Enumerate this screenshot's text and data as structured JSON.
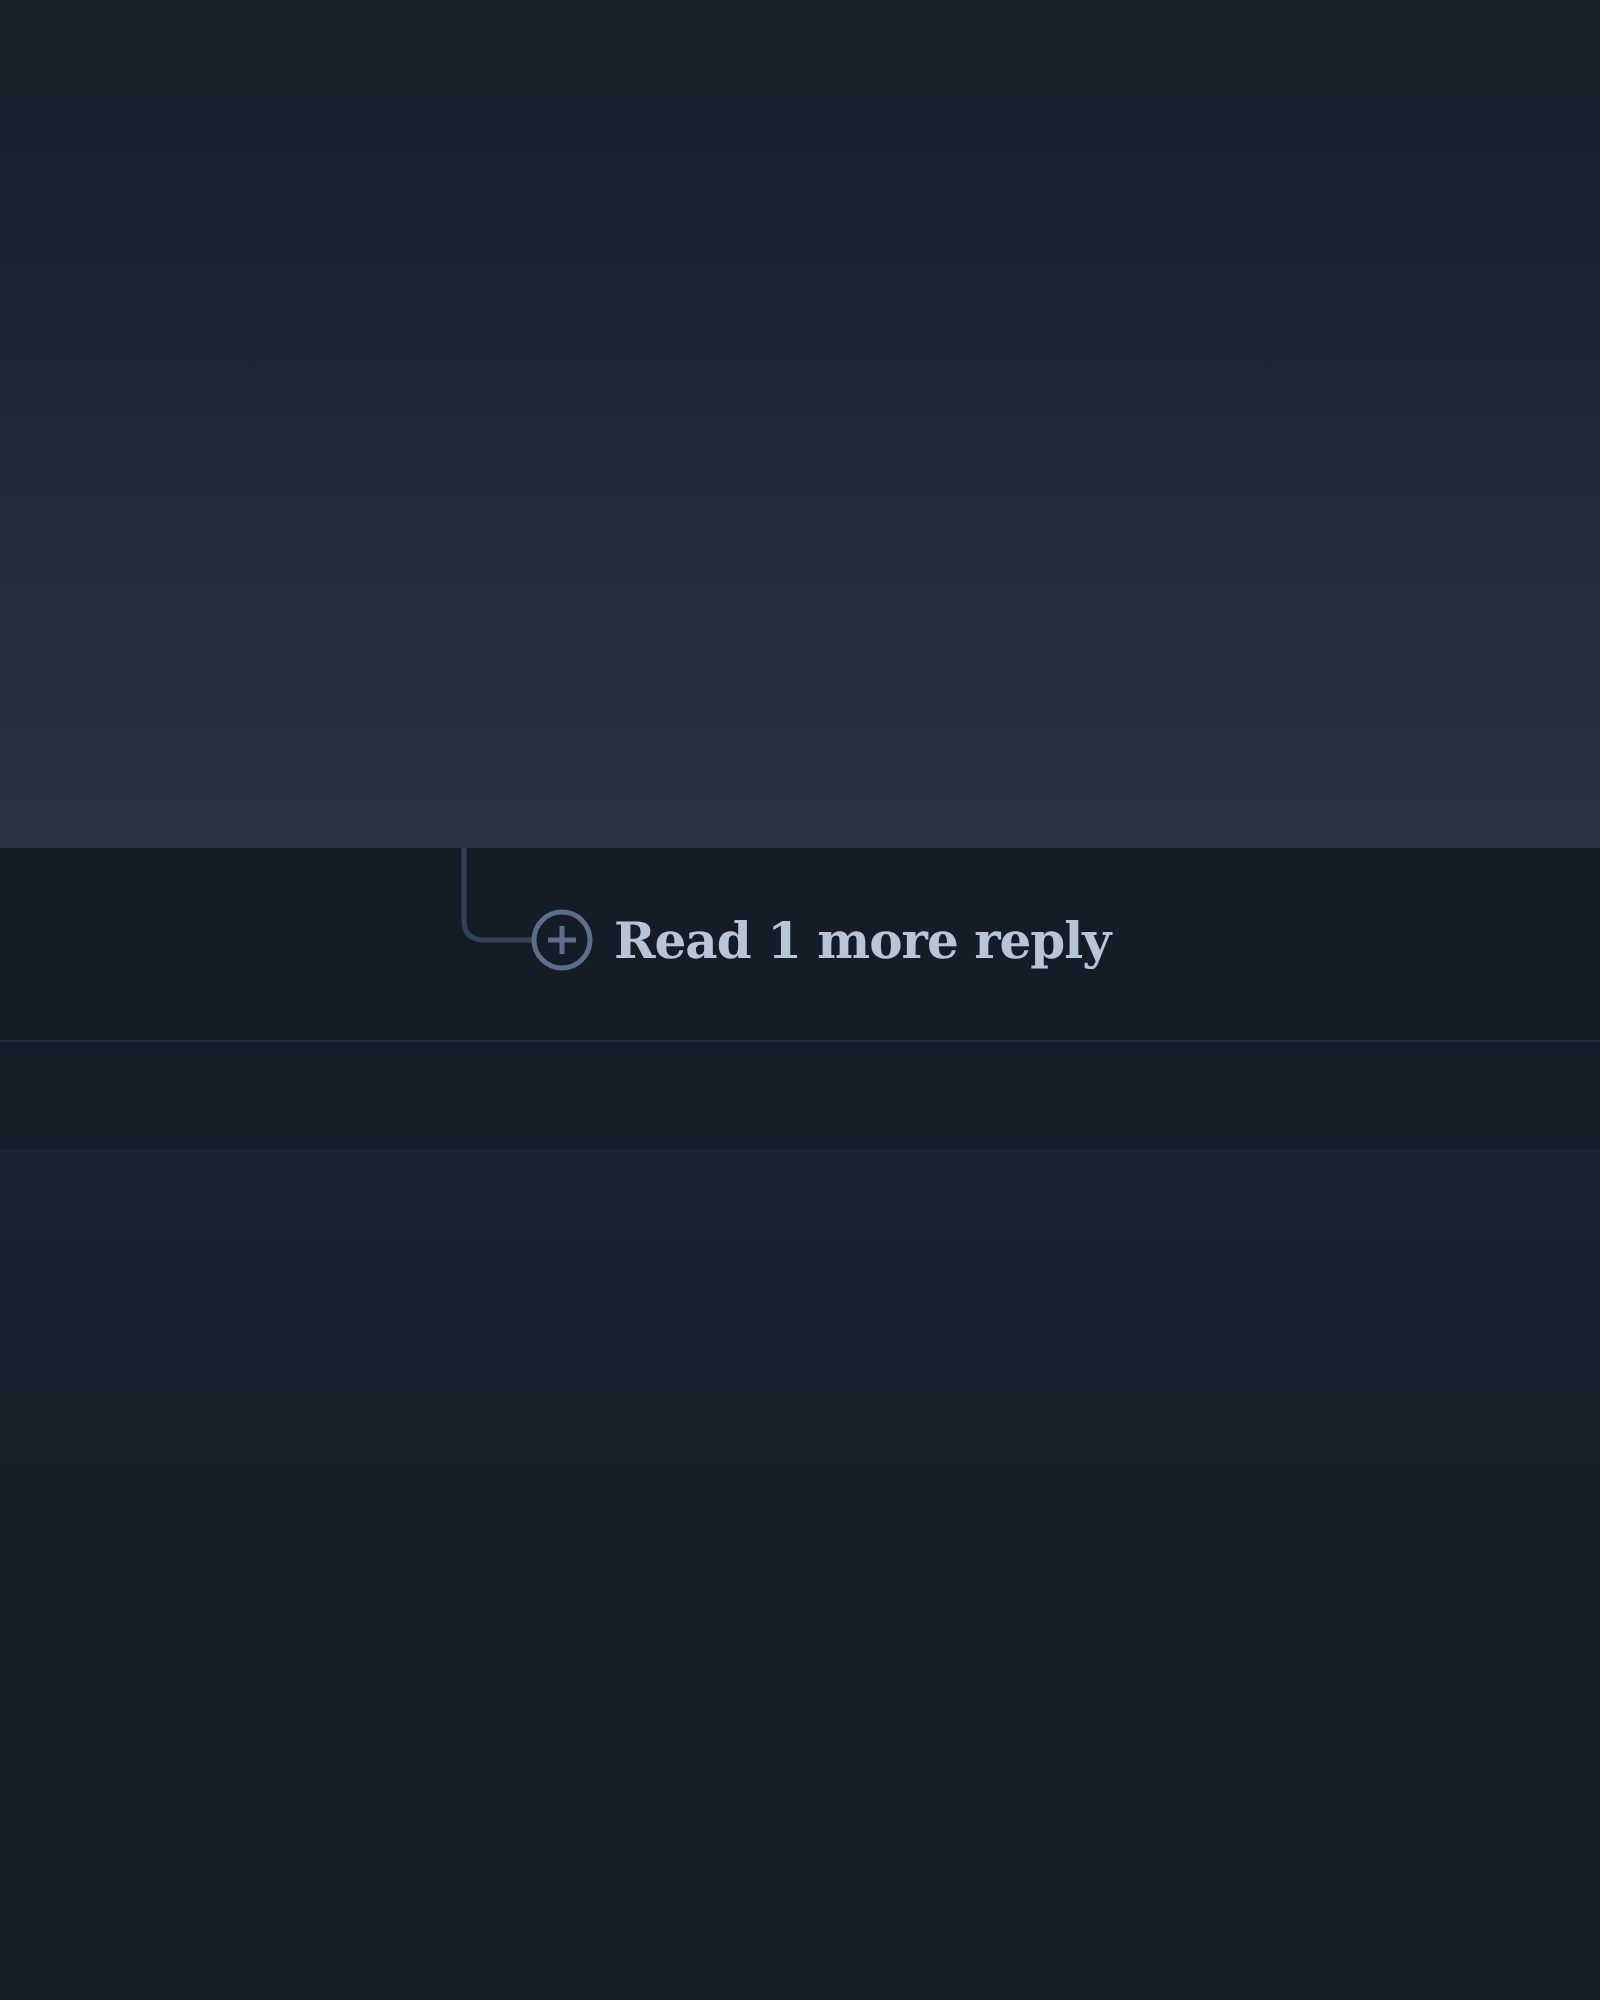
{
  "thread": {
    "more_replies": {
      "label": "Read 1 more reply"
    }
  }
}
